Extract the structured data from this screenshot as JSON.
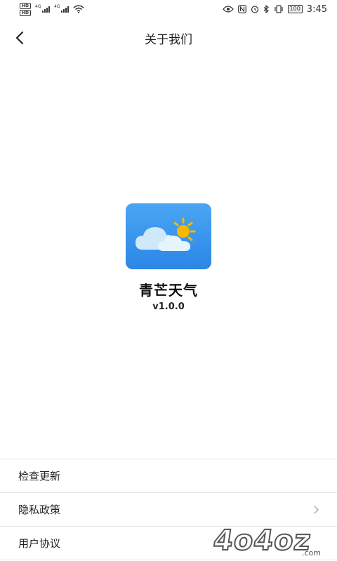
{
  "status_bar": {
    "hd1": "HD",
    "hd2": "HD",
    "net1": "4G",
    "net2": "4G",
    "battery": "100",
    "time": "3:45"
  },
  "header": {
    "title": "关于我们"
  },
  "app": {
    "name": "青芒天气",
    "version": "v1.0.0"
  },
  "menu": {
    "items": [
      {
        "label": "检查更新"
      },
      {
        "label": "隐私政策"
      },
      {
        "label": "用户协议"
      }
    ]
  },
  "watermark": {
    "text": "4o4oz",
    "suffix": ".com"
  },
  "colors": {
    "icon_gradient_top": "#4aa6f3",
    "icon_gradient_bottom": "#2b86e6",
    "sun": "#f5b800",
    "cloud": "#cfe9fb"
  }
}
